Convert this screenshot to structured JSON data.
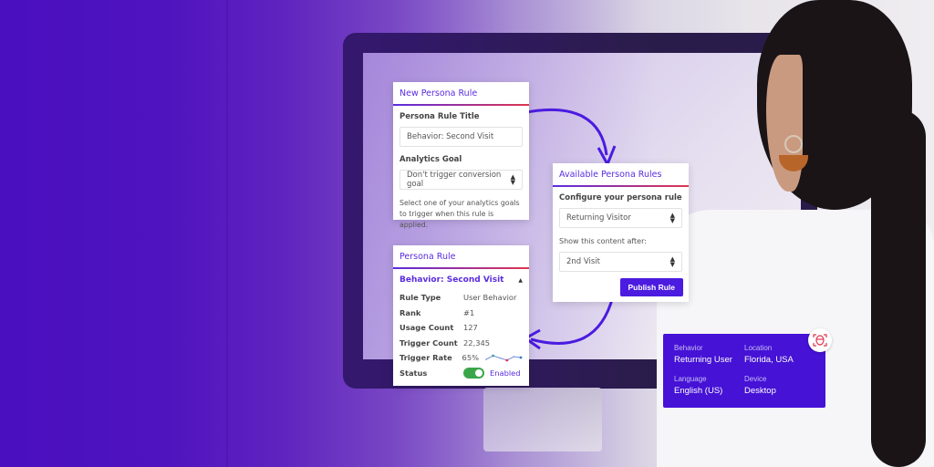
{
  "new_rule_card": {
    "title": "New Persona Rule",
    "title_label": "Persona Rule Title",
    "title_value": "Behavior: Second Visit",
    "goal_label": "Analytics Goal",
    "goal_value": "Don't trigger conversion goal",
    "hint": "Select one of your analytics goals to trigger when this rule is applied."
  },
  "available_card": {
    "title": "Available Persona Rules",
    "configure_label": "Configure your persona rule",
    "rule_value": "Returning Visitor",
    "show_after_label": "Show this content after:",
    "show_after_value": "2nd Visit",
    "publish_label": "Publish Rule"
  },
  "persona_rule_card": {
    "title": "Persona Rule",
    "rule_name": "Behavior: Second Visit",
    "collapse_icon": "triangle-up-icon",
    "rows": [
      {
        "key": "Rule Type",
        "value": "User Behavior"
      },
      {
        "key": "Rank",
        "value": "#1"
      },
      {
        "key": "Usage Count",
        "value": "127"
      },
      {
        "key": "Trigger Count",
        "value": "22,345"
      },
      {
        "key": "Trigger Rate",
        "value": "65%"
      }
    ],
    "status_label": "Status",
    "status_value": "Enabled",
    "status_on": true,
    "sparkline": [
      0.3,
      0.7,
      0.45,
      0.2,
      0.6,
      0.5
    ],
    "colors": {
      "accent": "#5a2ce0",
      "toggle": "#3aa64a"
    }
  },
  "visitor_info": {
    "items": [
      {
        "key": "Behavior",
        "value": "Returning User"
      },
      {
        "key": "Location",
        "value": "Florida, USA"
      },
      {
        "key": "Language",
        "value": "English (US)"
      },
      {
        "key": "Device",
        "value": "Desktop"
      }
    ],
    "badge_icon": "face-scan-icon",
    "background": "#4512d6"
  }
}
